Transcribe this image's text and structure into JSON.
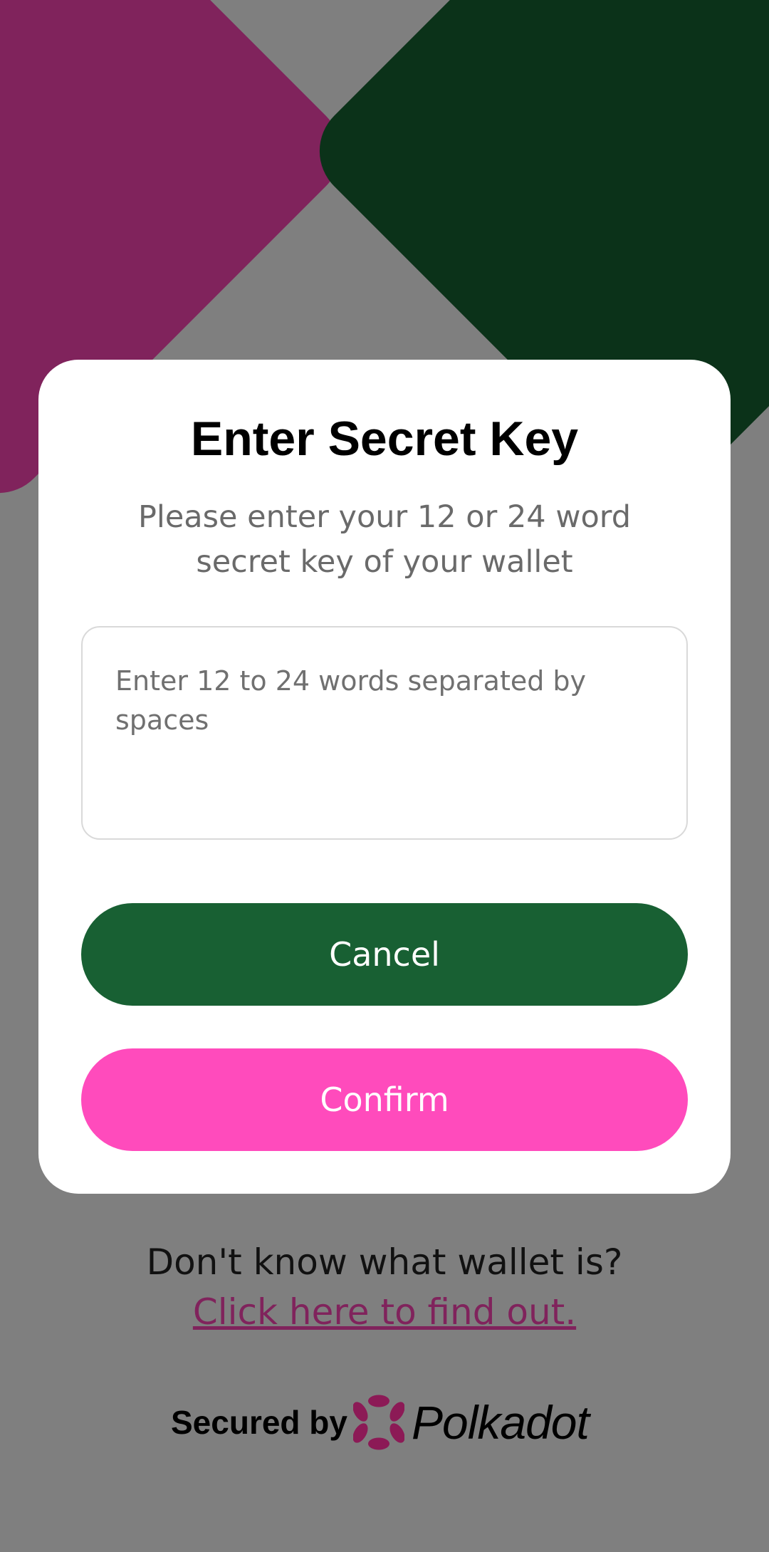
{
  "background": {
    "color": "#7f7f7f",
    "shape_left_color": "#80235c",
    "shape_right_color": "#0b3219"
  },
  "dialog": {
    "title": "Enter Secret Key",
    "subtitle": "Please enter your 12 or 24 word secret key of your wallet",
    "input": {
      "value": "",
      "placeholder": "Enter 12 to 24 words separated by spaces"
    },
    "cancel_label": "Cancel",
    "confirm_label": "Confirm",
    "cancel_color": "#186033",
    "confirm_color": "#ff4bbc"
  },
  "help": {
    "question": "Don't know what wallet is?",
    "link_label": "Click here to find out.",
    "link_color": "#80235c"
  },
  "footer": {
    "secured_by": "Secured by",
    "brand": "Polkadot",
    "brand_logo_icon": "polkadot-logo-icon",
    "brand_logo_color": "#8c1a56"
  }
}
